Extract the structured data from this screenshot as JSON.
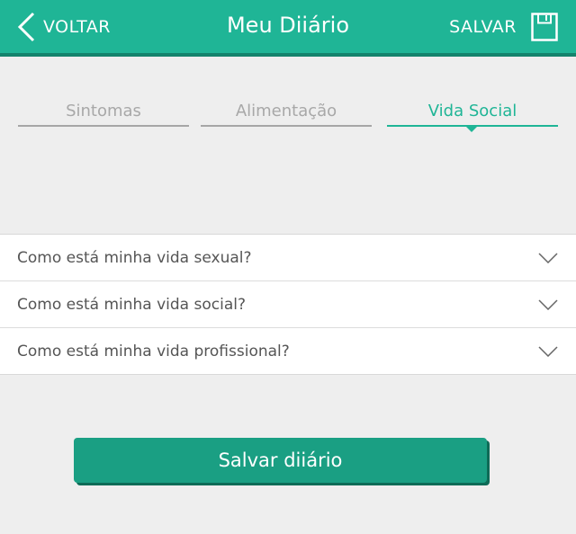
{
  "header": {
    "back_label": "VOLTAR",
    "title": "Meu Diiário",
    "save_label": "SALVAR"
  },
  "tabs": [
    {
      "label": "Sintomas",
      "active": false
    },
    {
      "label": "Alimentação",
      "active": false
    },
    {
      "label": "Vida Social",
      "active": true
    }
  ],
  "questions": [
    {
      "label": "Como está minha vida sexual?"
    },
    {
      "label": "Como está minha vida social?"
    },
    {
      "label": "Como está minha vida profissional?"
    }
  ],
  "submit_label": "Salvar diiário",
  "colors": {
    "accent": "#1fb596",
    "accent_dark": "#14836c",
    "button": "#1a9f83",
    "background": "#eeeeee"
  },
  "icons": {
    "back": "chevron-left-icon",
    "save": "floppy-disk-icon",
    "expand": "chevron-down-icon"
  }
}
